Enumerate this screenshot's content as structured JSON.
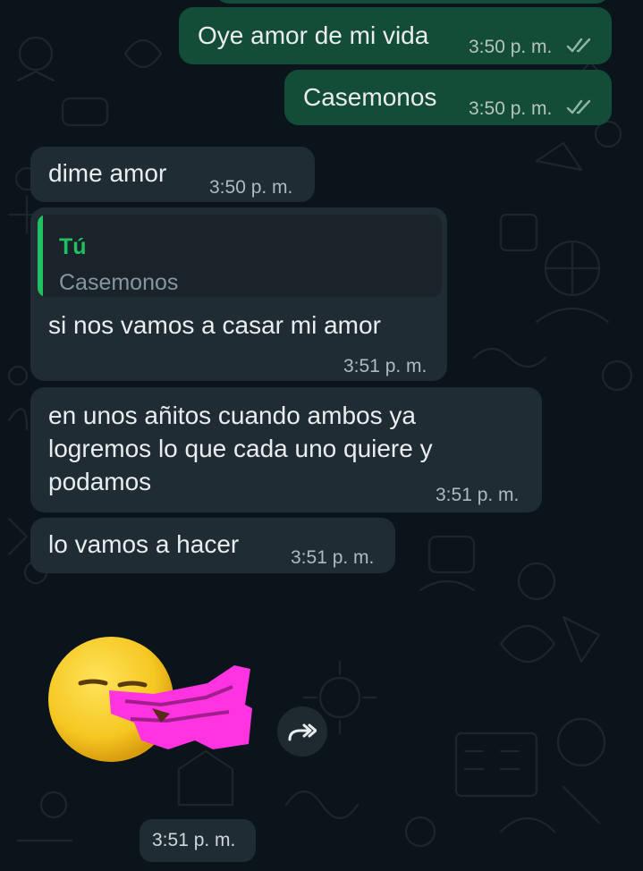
{
  "messages": [
    {
      "direction": "outgoing",
      "text": "Oye amor de mi vida",
      "time": "3:50 p. m.",
      "status": "read"
    },
    {
      "direction": "outgoing",
      "text": "Casemonos",
      "time": "3:50 p. m.",
      "status": "read"
    },
    {
      "direction": "incoming",
      "text": "dime amor",
      "time": "3:50 p. m."
    },
    {
      "direction": "incoming",
      "quote": {
        "author": "Tú",
        "text": "Casemonos"
      },
      "text": "si nos vamos a casar mi amor",
      "time": "3:51 p. m."
    },
    {
      "direction": "incoming",
      "lines": [
        "en unos añitos cuando ambos ya",
        "logremos lo que cada uno quiere y",
        "podamos"
      ],
      "time": "3:51 p. m."
    },
    {
      "direction": "incoming",
      "text": "lo vamos a hacer",
      "time": "3:51 p. m."
    },
    {
      "direction": "incoming",
      "type": "sticker",
      "sticker": "yawning-face-kiss-sticker",
      "time": "3:51 p. m."
    }
  ],
  "colors": {
    "background": "#0b141a",
    "outgoing_bubble": "#144d37",
    "incoming_bubble": "#202c33",
    "read_ticks": "#8fb6a4",
    "quote_accent": "#21c063"
  },
  "icons": {
    "read_receipt": "double-check-icon",
    "forward": "forward-icon"
  }
}
